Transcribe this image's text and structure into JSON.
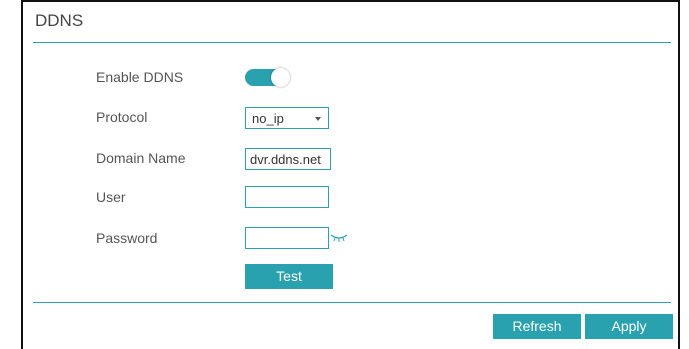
{
  "panel": {
    "title": "DDNS"
  },
  "form": {
    "enable_label": "Enable DDNS",
    "enable_state": true,
    "protocol_label": "Protocol",
    "protocol_value": "no_ip",
    "domain_label": "Domain Name",
    "domain_value": "dvr.ddns.net",
    "user_label": "User",
    "user_value": "",
    "password_label": "Password",
    "password_value": "",
    "test_label": "Test"
  },
  "footer": {
    "refresh_label": "Refresh",
    "apply_label": "Apply"
  },
  "colors": {
    "accent": "#2aa1ae"
  },
  "icons": {
    "password_toggle": "eye-closed-icon"
  }
}
